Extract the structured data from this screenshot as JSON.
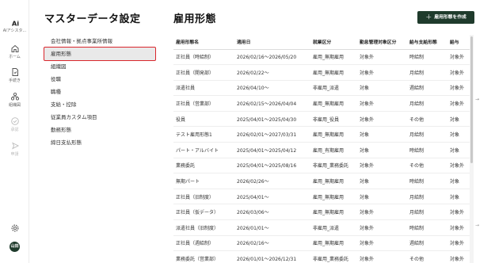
{
  "rail": {
    "logo_label": "AIアシスタ...",
    "items": [
      {
        "label": "ホーム",
        "icon": "home-icon",
        "disabled": false
      },
      {
        "label": "手続き",
        "icon": "document-icon",
        "disabled": false
      },
      {
        "label": "組織図",
        "icon": "org-chart-icon",
        "disabled": false
      },
      {
        "label": "承認",
        "icon": "check-circle-icon",
        "disabled": true
      },
      {
        "label": "申請",
        "icon": "send-icon",
        "disabled": true
      }
    ],
    "settings_icon": "gear-icon",
    "avatar_text": "山田"
  },
  "section": {
    "title": "マスターデータ設定",
    "items": [
      "会社情報・拠点事業所情報",
      "雇用形態",
      "組織図",
      "役職",
      "職種",
      "支給・控除",
      "従業員カスタム項目",
      "勤務形態",
      "締日支払形態"
    ],
    "active_index": 1
  },
  "main": {
    "title": "雇用形態",
    "create_button": "雇用形態を作成",
    "columns": [
      "雇用形態名",
      "適用日",
      "就業区分",
      "勤怠管理対象区分",
      "給与支給形態",
      "給与"
    ],
    "rows": [
      [
        "正社員（時給制）",
        "2026/02/16〜2026/05/20",
        "雇用_無期雇用",
        "対象外",
        "時給制",
        "対象外"
      ],
      [
        "正社員（開発部）",
        "2026/02/22〜",
        "雇用_無期雇用",
        "対象外",
        "月給制",
        "対象外"
      ],
      [
        "派遣社員",
        "2026/04/10〜",
        "非雇用_派遣",
        "対象",
        "週給制",
        "対象外"
      ],
      [
        "正社員（営業部）",
        "2026/02/15〜2026/04/04",
        "雇用_無期雇用",
        "対象外",
        "月給制",
        "対象外"
      ],
      [
        "役員",
        "2025/04/01〜2025/04/30",
        "非雇用_役員",
        "対象外",
        "その他",
        "対象"
      ],
      [
        "テスト雇用形態1",
        "2026/02/01〜2027/03/31",
        "雇用_無期雇用",
        "対象",
        "月給制",
        "対象"
      ],
      [
        "パート・アルバイト",
        "2025/04/01〜2025/04/12",
        "雇用_有期雇用",
        "対象",
        "時給制",
        "対象"
      ],
      [
        "業務委託",
        "2025/04/01〜2025/08/16",
        "非雇用_業務委託",
        "対象外",
        "その他",
        "対象外"
      ],
      [
        "無期パート",
        "2026/02/26〜",
        "雇用_無期雇用",
        "対象",
        "時給制",
        "対象"
      ],
      [
        "正社員（旧制度）",
        "2025/04/01〜",
        "雇用_無期雇用",
        "対象",
        "月給制",
        "対象"
      ],
      [
        "正社員（仮データ）",
        "2026/03/06〜",
        "雇用_無期雇用",
        "対象外",
        "月給制",
        "対象外"
      ],
      [
        "派遣社員（旧制度）",
        "2026/01/01〜",
        "非雇用_派遣",
        "対象外",
        "時給制",
        "対象外"
      ],
      [
        "正社員（週給制）",
        "2026/02/16〜",
        "雇用_無期雇用",
        "対象外",
        "週給制",
        "対象外"
      ],
      [
        "業務委託（営業部）",
        "2026/01/01〜2026/12/31",
        "非雇用_業務委託",
        "対象外",
        "その他",
        "対象外"
      ]
    ]
  },
  "colors": {
    "accent": "#1f3b2c",
    "active_outline": "#d9262c"
  }
}
